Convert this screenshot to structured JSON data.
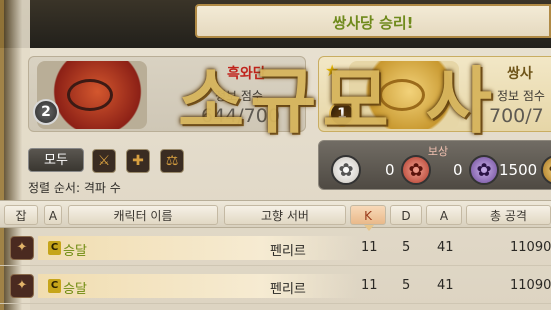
{
  "header": {
    "result_text": "쌍사당 승리!"
  },
  "overlay_text": "소규모 사",
  "team_left": {
    "rank": "2",
    "name": "흑와단",
    "score_label": "정보 점수",
    "score": "644/700"
  },
  "team_right": {
    "rank": "1",
    "name": "쌍사",
    "score_label": "정보 점수",
    "score": "700/7"
  },
  "filters": {
    "all_label": "모두",
    "role_icons": [
      "tank-icon",
      "healer-icon",
      "dps-icon"
    ]
  },
  "sort": {
    "label": "정렬 순서: 격파 수"
  },
  "rewards": {
    "title": "보상",
    "items": [
      {
        "icon": "white-medal-icon",
        "value": "0"
      },
      {
        "icon": "red-medal-icon",
        "value": "0"
      },
      {
        "icon": "purple-medal-icon",
        "value": "1500"
      },
      {
        "icon": "gold-medal-icon",
        "value": ""
      }
    ]
  },
  "table": {
    "headers": {
      "job": "잡",
      "grade": "A",
      "name": "캐릭터 이름",
      "server": "고향 서버",
      "k": "K",
      "d": "D",
      "a": "A",
      "damage": "총 공격"
    },
    "rows": [
      {
        "grade": "C",
        "name": "승달",
        "server": "펜리르",
        "k": "11",
        "d": "5",
        "a": "41",
        "damage": "11090"
      },
      {
        "grade": "C",
        "name": "승달",
        "server": "펜리르",
        "k": "11",
        "d": "5",
        "a": "41",
        "damage": "11090"
      }
    ]
  },
  "colors": {
    "winner": "#6f8a1c",
    "loser_name": "#c0231c",
    "accent_gold": "#d6b45c"
  }
}
